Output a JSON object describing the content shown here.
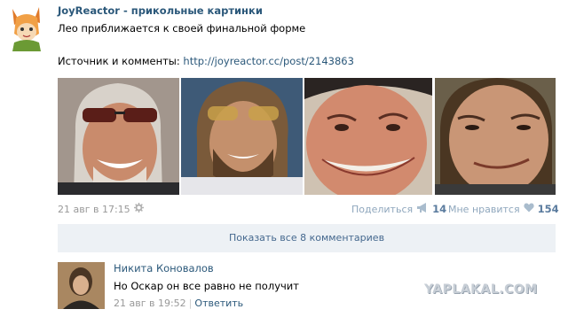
{
  "post": {
    "author": "JoyReactor - прикольные картинки",
    "text": "Лео приближается к своей финальной форме",
    "source_label": "Источник и комменты:",
    "source_link": "http://joyreactor.cc/post/2143863",
    "photos": [
      "photo-1",
      "photo-2",
      "photo-3",
      "photo-4"
    ],
    "date": "21 авг в 17:15",
    "share_label": "Поделиться",
    "share_count": "14",
    "like_label": "Мне нравится",
    "like_count": "154",
    "show_all": "Показать все 8 комментариев"
  },
  "comment": {
    "author": "Никита Коновалов",
    "text": "Но Оскар он все равно не получит",
    "date": "21 авг в 19:52",
    "reply": "Ответить"
  },
  "watermark": "YAPLAKAL.COM",
  "colors": {
    "link": "#2b587a",
    "panel": "#edf1f5",
    "muted": "#999999"
  }
}
